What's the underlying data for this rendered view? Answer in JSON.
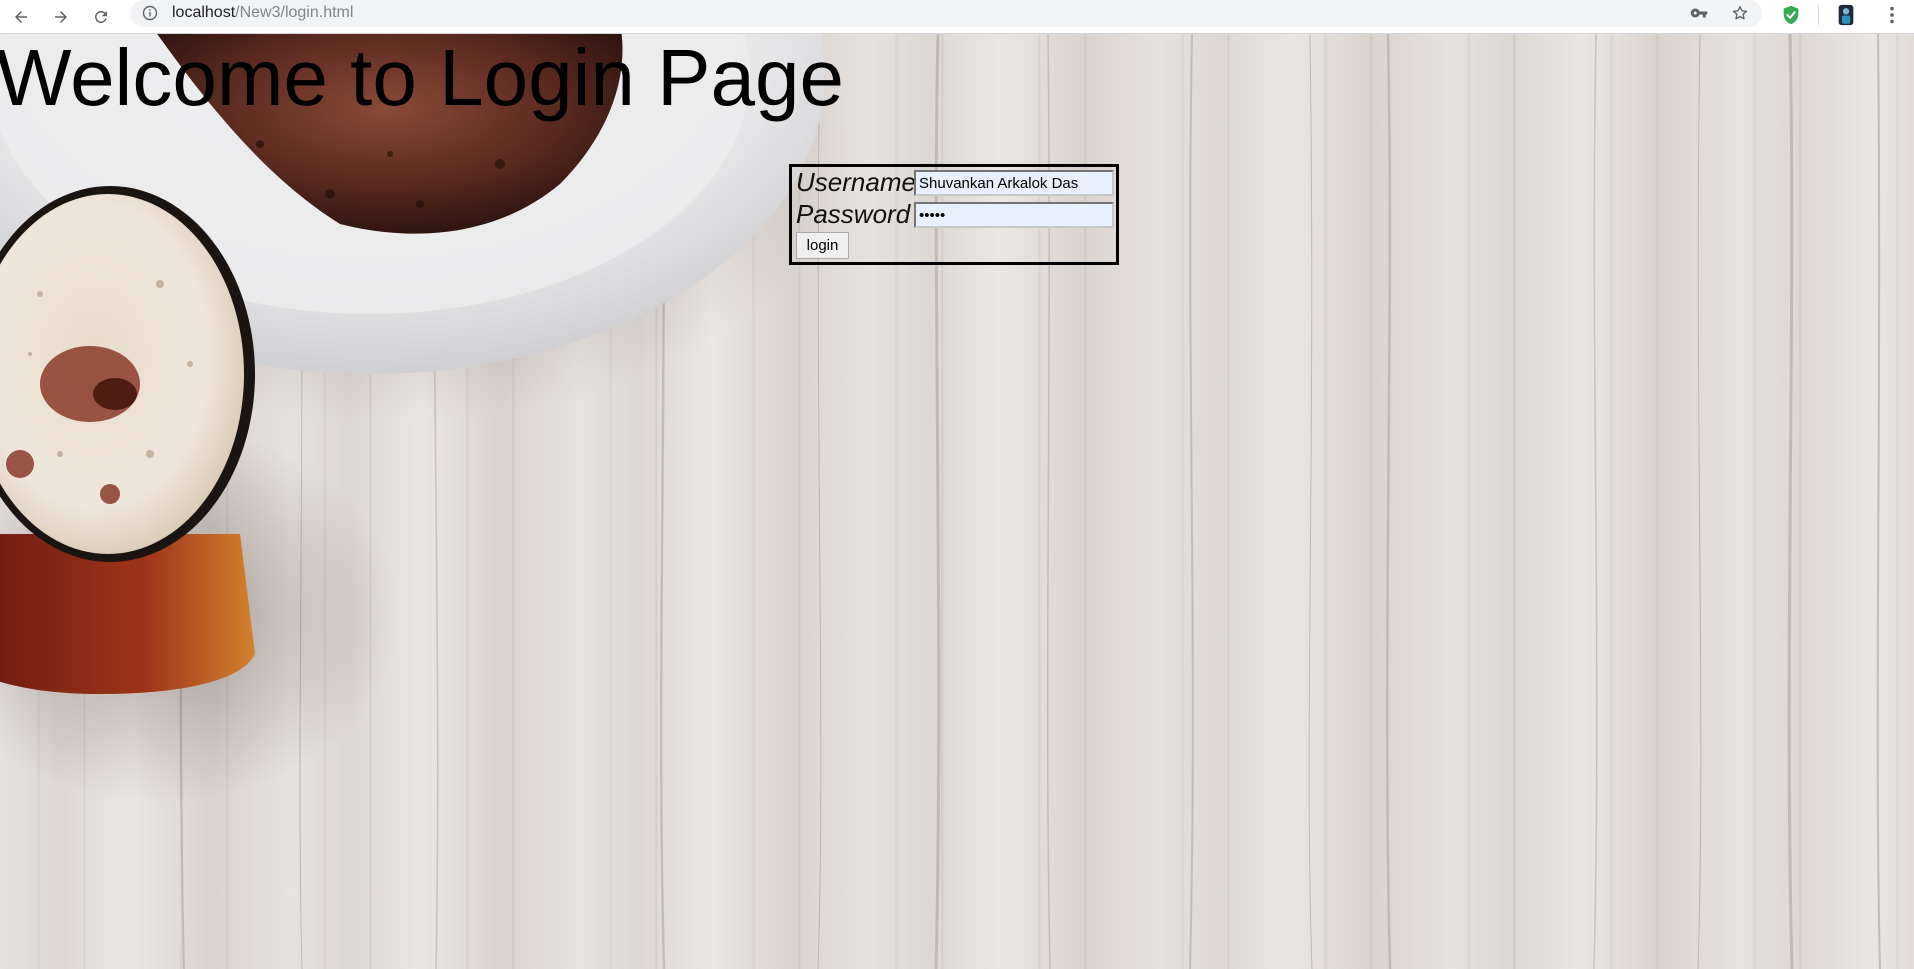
{
  "browser": {
    "url_host": "localhost",
    "url_path": "/New3/login.html"
  },
  "page": {
    "title": "Welcome to Login Page"
  },
  "login_form": {
    "username_label": "Username",
    "username_value": "Shuvankan Arkalok Das",
    "password_label": "Password",
    "password_value": "•••••",
    "submit_label": "login"
  },
  "colors": {
    "input_autofill": "#e8f0fe",
    "form_border": "#000000",
    "shield_extension": "#34a853"
  },
  "icons": {
    "back": "back-arrow-icon",
    "forward": "forward-arrow-icon",
    "reload": "reload-icon",
    "site_info": "info-icon",
    "saved_password": "key-icon",
    "bookmark": "star-icon",
    "extension_1": "shield-check-icon",
    "extension_2": "profile-avatar-icon",
    "menu": "kebab-menu-icon"
  }
}
